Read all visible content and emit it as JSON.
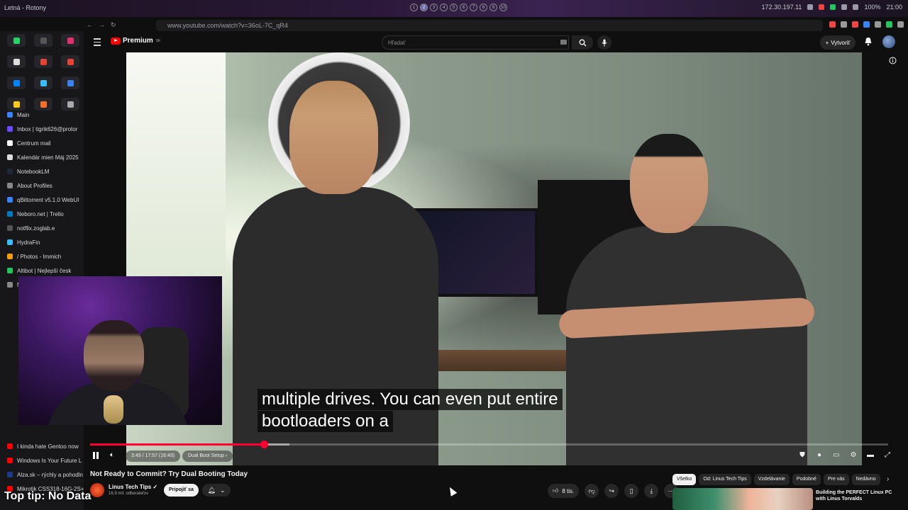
{
  "os": {
    "window_title": "Letná - Rotony",
    "workspaces": [
      "1",
      "2",
      "3",
      "4",
      "5",
      "6",
      "7",
      "8",
      "9",
      "10"
    ],
    "active_workspace": 1,
    "ip": "172.30.197.11",
    "battery": "100%",
    "clock": "21:00"
  },
  "browser": {
    "url": "www.youtube.com/watch?v=36oL-7C_qR4"
  },
  "sidebar": {
    "pinned": [
      {
        "icon": "whatsapp-icon",
        "color": "#25d366"
      },
      {
        "icon": "blank-tab-icon",
        "color": "#555555"
      },
      {
        "icon": "instagram-icon",
        "color": "#e1306c"
      },
      {
        "icon": "x-icon",
        "color": "#dddddd"
      },
      {
        "icon": "gmail-icon",
        "color": "#ea4335"
      },
      {
        "icon": "gmail-icon",
        "color": "#ea4335"
      },
      {
        "icon": "messenger-icon",
        "color": "#0084ff"
      },
      {
        "icon": "drop-icon",
        "color": "#38bdf8"
      },
      {
        "icon": "outlook-icon",
        "color": "#3b82f6"
      },
      {
        "icon": "notes-icon",
        "color": "#facc15"
      },
      {
        "icon": "gitlab-icon",
        "color": "#fc6d26"
      },
      {
        "icon": "gear-icon",
        "color": "#aaaaaa"
      }
    ],
    "tabs": [
      {
        "label": "Main",
        "color": "#3b82f6"
      },
      {
        "label": "Inbox | tigrik626@protor",
        "color": "#6d4aff"
      },
      {
        "label": "Centrum mail",
        "color": "#ffffff"
      },
      {
        "label": "Kalendár mien Máj 2025",
        "color": "#dddddd"
      },
      {
        "label": "NotebookLM",
        "color": "#1f2937"
      },
      {
        "label": "About Profiles",
        "color": "#888888"
      },
      {
        "label": "qBittorrent v5.1.0 WebUI",
        "color": "#3b82f6"
      },
      {
        "label": "Neboro.net | Trello",
        "color": "#0079bf"
      },
      {
        "label": "notflix.zoglab.e",
        "color": "#555555"
      },
      {
        "label": "HydraFin",
        "color": "#38bdf8"
      },
      {
        "label": "/ Photos - Immich",
        "color": "#f59e0b"
      },
      {
        "label": "Altibot | Nejlepší česk",
        "color": "#22c55e"
      },
      {
        "label": "M",
        "color": "#888888"
      }
    ],
    "lower_tabs": [
      {
        "label": "I kinda hate Gentoo now",
        "color": "#ff0000"
      },
      {
        "label": "Windows Is Your Future L",
        "color": "#ff0000"
      },
      {
        "label": "Alza.sk – rýchly a pohodln",
        "color": "#1e3a8a"
      },
      {
        "label": "Mikrotik CSS318-16G-2S+",
        "color": "#ff0000"
      }
    ]
  },
  "youtube": {
    "logo_text": "Premium",
    "logo_badge": "SK",
    "search_placeholder": "Hľadať",
    "create_label": "Vytvoriť",
    "captions": [
      "multiple drives. You can even put entire",
      "bootloaders on a"
    ],
    "player": {
      "time": "3:49 / 17:57 (16:49)",
      "chapter": "Dual Boot Setup",
      "progress_played": 0.218,
      "progress_loaded": 0.25
    },
    "video_title": "Not Ready to Commit? Try Dual Booting Today",
    "channel": {
      "name": "Linus Tech Tips",
      "subscribers": "16,9 mil. odberateľov",
      "join_label": "Pripojiť sa"
    },
    "likes": "8 tis.",
    "chips": [
      "Všetko",
      "Od: Linus Tech Tips",
      "Vzdelávanie",
      "Podobné",
      "Pre vás",
      "Nedávno"
    ],
    "recommended": {
      "title": "Building the PERFECT Linux PC with Linus Torvalds"
    }
  },
  "overlay": {
    "top_tip": "Top tip: No Data"
  }
}
